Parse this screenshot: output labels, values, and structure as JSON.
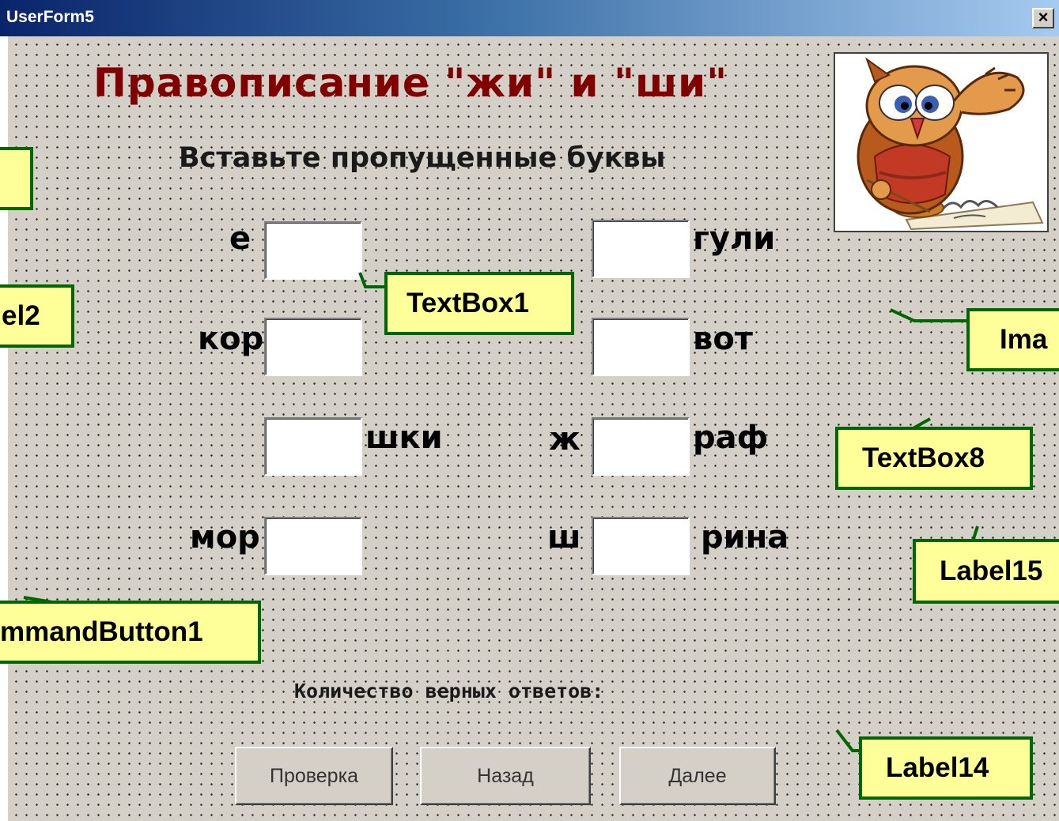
{
  "window": {
    "title": "UserForm5",
    "close_label": "×"
  },
  "form": {
    "title": "Правописание \"жи\" и \"ши\"",
    "subtitle": "Вставьте пропущенные буквы",
    "words": {
      "e": "е",
      "guli": "гули",
      "kor": "кор",
      "vot": "вот",
      "shki": "шки",
      "zh": "ж",
      "raf": "раф",
      "mor": "мор",
      "sh": "ш",
      "rina": "рина"
    },
    "inputs": [
      "",
      "",
      "",
      "",
      "",
      "",
      "",
      ""
    ],
    "count_label": "Количество верных ответов:",
    "buttons": {
      "check": "Проверка",
      "back": "Назад",
      "next": "Далее"
    }
  },
  "callouts": {
    "textbox1": "TextBox1",
    "label2": "el2",
    "image": "Ima",
    "textbox8": "TextBox8",
    "label15": "Label15",
    "commandbutton1": "mmandButton1",
    "label14": "Label14"
  },
  "colors": {
    "callout_fill": "#ffff99",
    "callout_border": "#006600",
    "title_color": "#800000"
  }
}
